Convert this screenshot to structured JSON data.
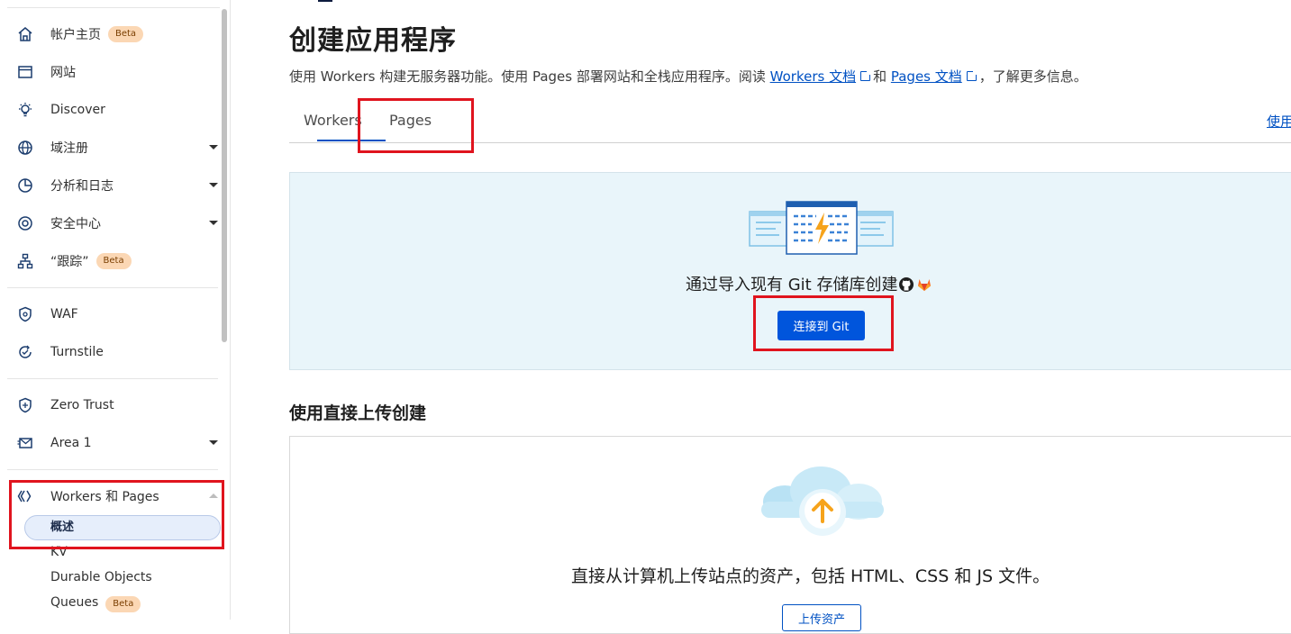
{
  "sidebar": {
    "items": [
      {
        "label": "帐户主页",
        "badge": "Beta",
        "icon": "home-icon"
      },
      {
        "label": "网站",
        "icon": "window-icon"
      },
      {
        "label": "Discover",
        "icon": "lightbulb-icon"
      },
      {
        "label": "域注册",
        "icon": "globe-icon"
      },
      {
        "label": "分析和日志",
        "icon": "pie-chart-icon"
      },
      {
        "label": "安全中心",
        "icon": "shield-gear-icon"
      },
      {
        "label": "“跟踪”",
        "badge": "Beta",
        "icon": "network-icon"
      },
      {
        "label": "WAF",
        "icon": "waf-shield-icon"
      },
      {
        "label": "Turnstile",
        "icon": "turnstile-icon"
      },
      {
        "label": "Zero Trust",
        "icon": "zero-trust-icon"
      },
      {
        "label": "Area 1",
        "icon": "envelope-icon"
      },
      {
        "label": "Workers 和 Pages",
        "icon": "workers-icon"
      }
    ],
    "sub_items": {
      "active": "概述",
      "kv": "KV",
      "durable_objects": "Durable Objects",
      "queues": "Queues",
      "queues_badge": "Beta"
    }
  },
  "main": {
    "title": "创建应用程序",
    "description": {
      "part1": "使用 Workers 构建无服务器功能。使用 Pages 部署网站和全栈应用程序。阅读 ",
      "workers_link": "Workers 文档",
      "part2": "和 ",
      "pages_link": "Pages 文档",
      "part3": "，了解更多信息。"
    },
    "tabs": [
      {
        "label": "Workers"
      },
      {
        "label": "Pages",
        "active": true
      }
    ],
    "right_link": "使用",
    "git_panel": {
      "text": "通过导入现有 Git 存储库创建",
      "button": "连接到 Git"
    },
    "upload_section": {
      "title": "使用直接上传创建",
      "text": "直接从计算机上传站点的资产，包括 HTML、CSS 和 JS 文件。",
      "button": "上传资产"
    }
  },
  "colors": {
    "accent": "#0051c3",
    "button": "#0055dc",
    "highlight_box": "#e0141e",
    "badge": "#fbd7b4",
    "git_panel_bg": "#e9f5fa"
  }
}
